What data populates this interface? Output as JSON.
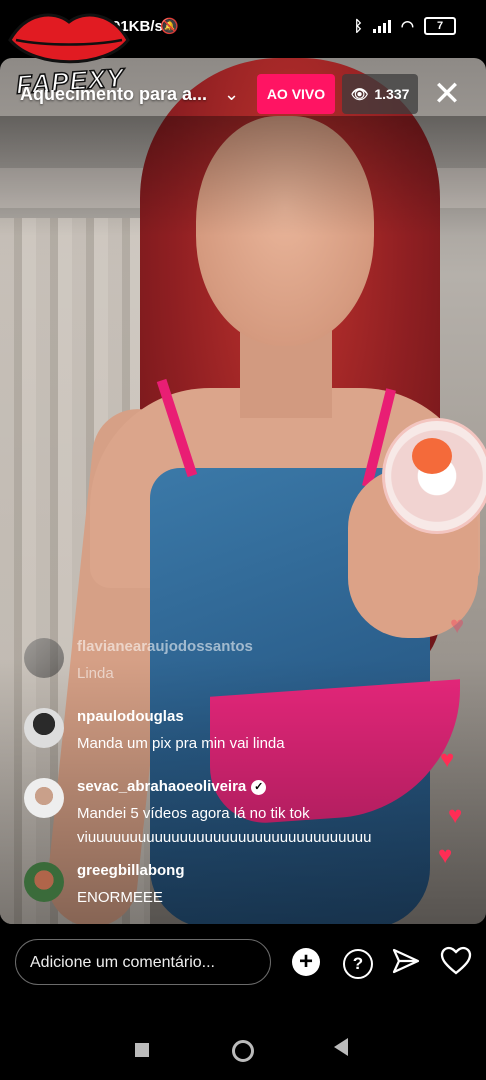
{
  "status_bar": {
    "network_speed": "01KB/s",
    "battery": "7"
  },
  "watermark": {
    "text": "FAPEXY"
  },
  "live": {
    "title": "Aquecimento para a...",
    "badge": "AO VIVO",
    "viewers": "1.337"
  },
  "comments": [
    {
      "user": "flavianearaujodossantos",
      "text": "Linda",
      "verified": false
    },
    {
      "user": "npaulodouglas",
      "text": "Manda um pix pra min  vai linda",
      "verified": false
    },
    {
      "user": "sevac_abrahaoeoliveira",
      "text": "Mandei 5 vídeos agora lá no tik tok viuuuuuuuuuuuuuuuuuuuuuuuuuuuuuuuuuu",
      "verified": true
    },
    {
      "user": "greegbillabong",
      "text": "ENORMEEE",
      "verified": false
    }
  ],
  "comment_input": {
    "placeholder": "Adicione um comentário..."
  },
  "colors": {
    "live_badge": "#ff1463",
    "heart": "#ff2d55"
  }
}
